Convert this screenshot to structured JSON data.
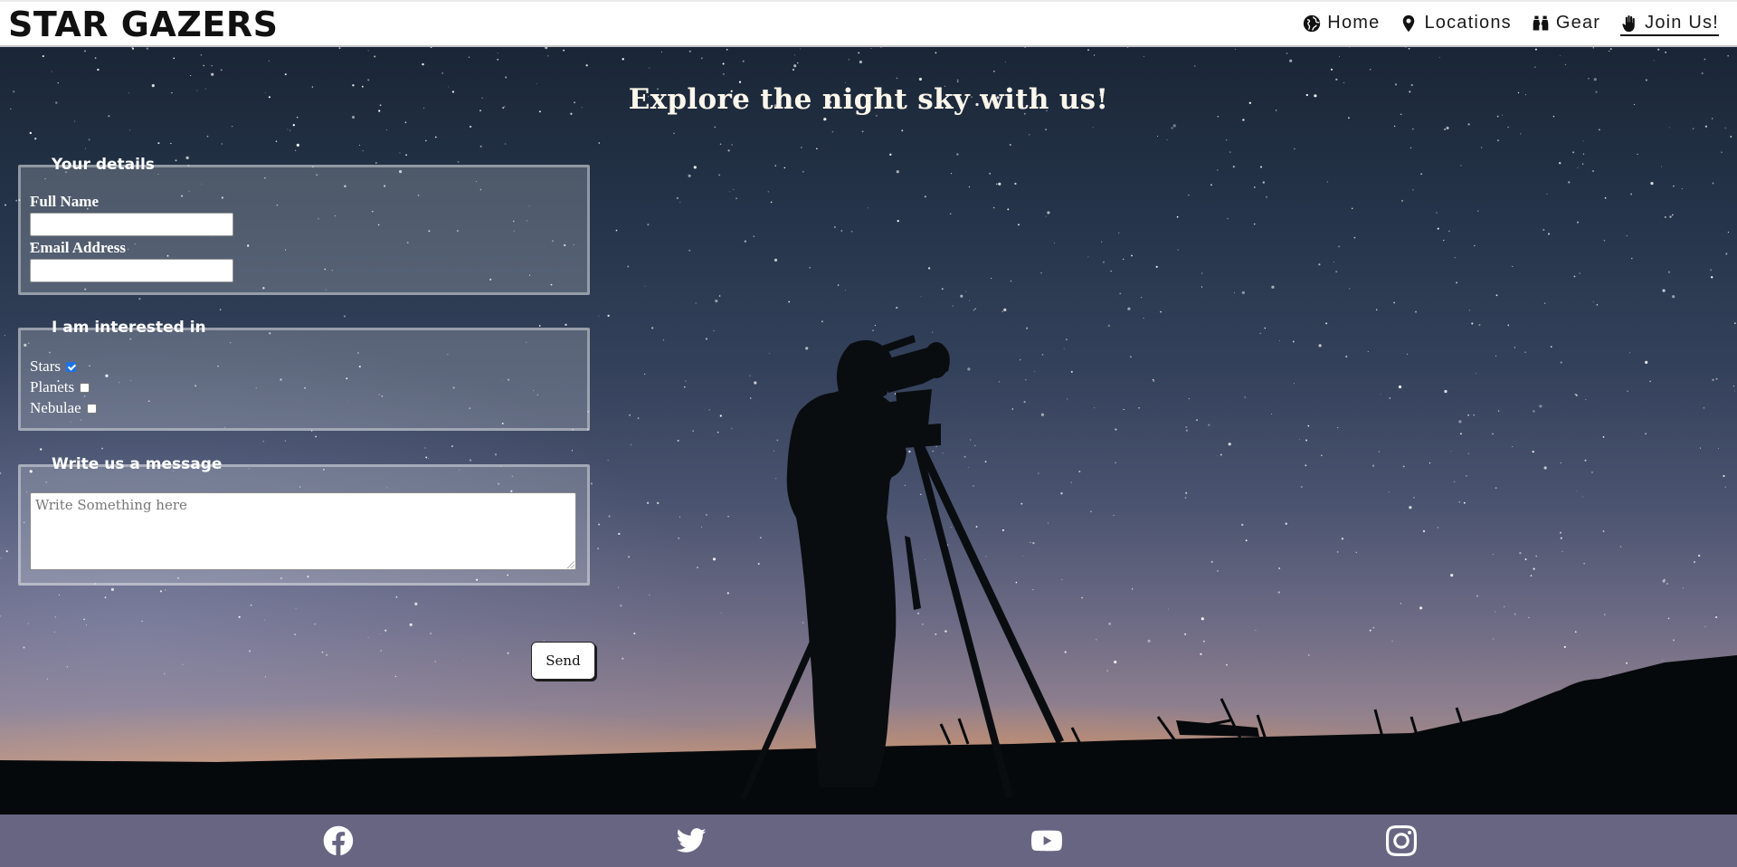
{
  "header": {
    "brand": "STAR GAZERS",
    "nav": [
      {
        "label": "Home",
        "icon": "globe-icon",
        "active": false
      },
      {
        "label": "Locations",
        "icon": "map-pin-icon",
        "active": false
      },
      {
        "label": "Gear",
        "icon": "binoculars-icon",
        "active": false
      },
      {
        "label": "Join Us!",
        "icon": "hand-icon",
        "active": true
      }
    ]
  },
  "hero": {
    "title": "Explore the night sky with us!"
  },
  "form": {
    "details": {
      "legend": "Your details",
      "full_name_label": "Full Name",
      "full_name_value": "",
      "email_label": "Email Address",
      "email_value": ""
    },
    "interests": {
      "legend": "I am interested in",
      "options": [
        {
          "label": "Stars",
          "checked": true
        },
        {
          "label": "Planets",
          "checked": false
        },
        {
          "label": "Nebulae",
          "checked": false
        }
      ]
    },
    "message": {
      "legend": "Write us a message",
      "placeholder": "Write Something here",
      "value": ""
    },
    "send_label": "Send"
  },
  "footer": {
    "social": [
      "facebook-icon",
      "twitter-icon",
      "youtube-icon",
      "instagram-icon"
    ]
  },
  "colors": {
    "footer_bg": "#686583",
    "checkbox_checked": "#1d72e8"
  }
}
